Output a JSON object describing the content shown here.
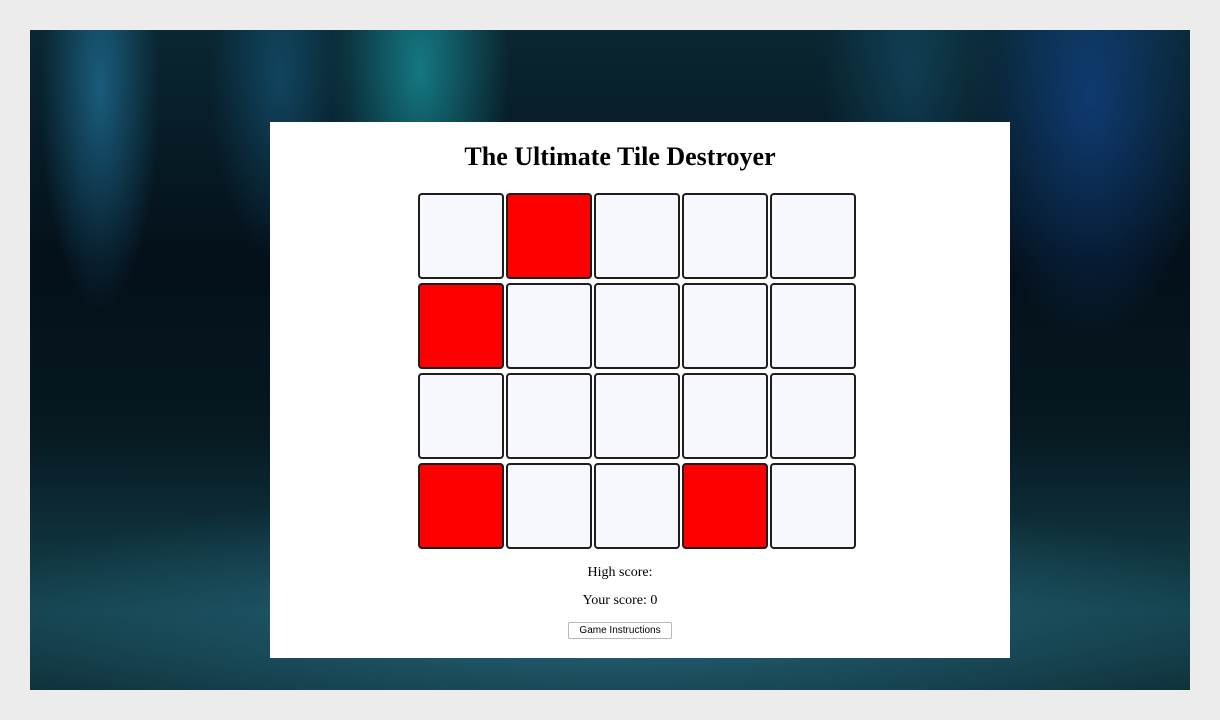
{
  "game": {
    "title": "The Ultimate Tile Destroyer",
    "rows": 4,
    "columns": 5,
    "tiles": [
      [
        false,
        true,
        false,
        false,
        false
      ],
      [
        true,
        false,
        false,
        false,
        false
      ],
      [
        false,
        false,
        false,
        false,
        false
      ],
      [
        true,
        false,
        false,
        true,
        false
      ]
    ],
    "high_score_label": "High score:",
    "your_score_label": "Your score: 0",
    "instructions_button_label": "Game Instructions"
  },
  "colors": {
    "tile_active": "#ff0000",
    "tile_inactive": "#f7f8fd",
    "tile_border": "#1e1e1e",
    "card_background": "#ffffff"
  }
}
